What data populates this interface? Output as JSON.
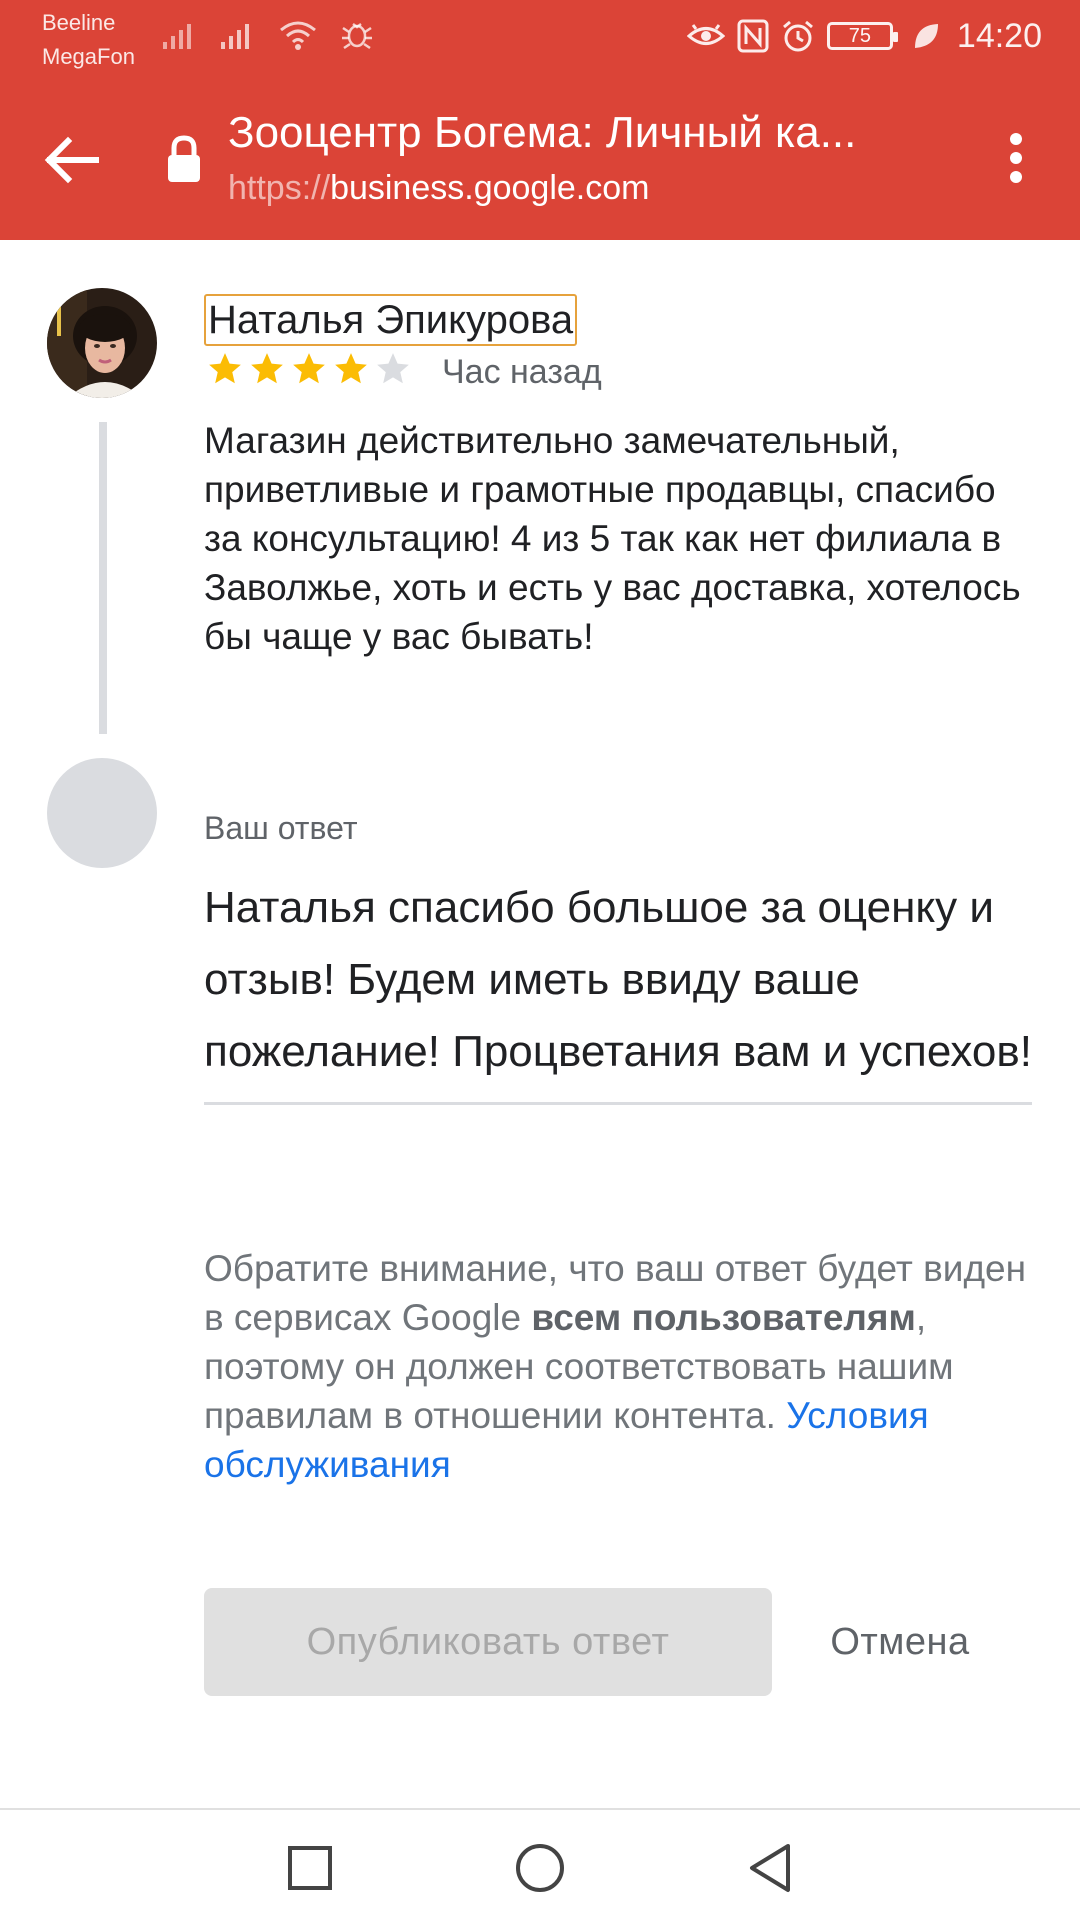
{
  "status_bar": {
    "carrier_1": "Beeline",
    "carrier_2": "MegaFon",
    "battery": "75",
    "time": "14:20"
  },
  "app_bar": {
    "title": "Зооцентр Богема: Личный ка...",
    "url_scheme": "https://",
    "url_host": "business.google.com"
  },
  "review": {
    "author": "Наталья Эпикурова",
    "rating": 4,
    "rating_max": 5,
    "time": "Час назад",
    "text": "Магазин действительно замечательный, приветливые и грамотные продавцы, спасибо за консультацию! 4 из 5 так как нет филиала в Заволжье, хоть и есть у вас доставка, хотелось бы чаще у вас бывать!"
  },
  "reply": {
    "label": "Ваш ответ",
    "text": "Наталья спасибо большое за оценку и отзыв! Будем иметь ввиду ваше пожелание! Процветания вам и успехов!"
  },
  "notice": {
    "part1": "Обратите внимание, что ваш ответ будет виден в сервисах Google ",
    "bold": "всем пользователям",
    "part2": ", поэтому он должен соответствовать нашим правилам в отношении контента. ",
    "link": "Условия обслуживания"
  },
  "actions": {
    "publish_label": "Опубликовать ответ",
    "cancel_label": "Отмена"
  },
  "colors": {
    "app_bar": "#db4437",
    "star_filled": "#fbbc04",
    "star_empty": "#dadce0",
    "link": "#1a73e8"
  },
  "icons": {
    "back": "arrow-back-icon",
    "lock": "lock-icon",
    "menu": "more-vert-icon",
    "nav_recents": "square-icon",
    "nav_home": "circle-icon",
    "nav_back": "triangle-icon"
  }
}
